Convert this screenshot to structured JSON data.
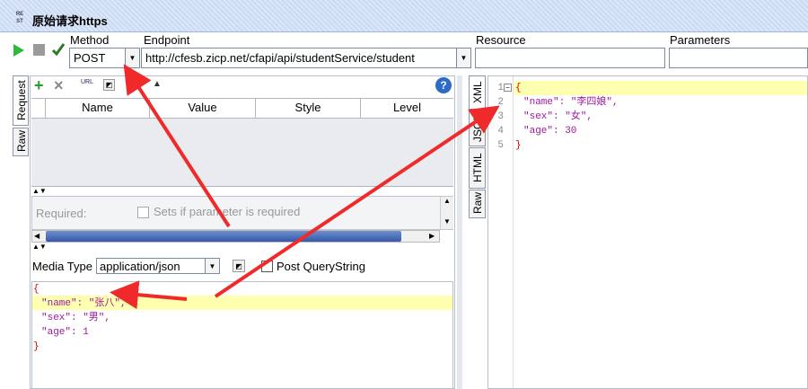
{
  "window": {
    "title": "原始请求https",
    "badge_top": "RE",
    "badge_bottom": "ST"
  },
  "toolbar": {
    "method_label": "Method",
    "method_value": "POST",
    "endpoint_label": "Endpoint",
    "endpoint_value": "http://cfesb.zicp.net/cfapi/api/studentService/student",
    "resource_label": "Resource",
    "parameters_label": "Parameters"
  },
  "request_tabs": {
    "request": "Request",
    "raw": "Raw"
  },
  "params_table": {
    "headers": [
      "Name",
      "Value",
      "Style",
      "Level"
    ]
  },
  "required": {
    "label": "Required:",
    "checkbox_label": "Sets if parameter is required"
  },
  "media": {
    "label": "Media Type",
    "value": "application/json",
    "post_qs_label": "Post QueryString"
  },
  "request_body": {
    "lines": [
      "{",
      "\"name\": \"张八\",",
      "\"sex\": \"男\",",
      "\"age\": 1",
      "}"
    ]
  },
  "response_tabs": {
    "xml": "XML",
    "json": "JSON",
    "html": "HTML",
    "raw": "Raw"
  },
  "response_body": {
    "line_numbers": [
      "1",
      "2",
      "3",
      "4",
      "5"
    ],
    "lines": [
      "{",
      "\"name\": \"李四娘\",",
      "\"sex\": \"女\",",
      "\"age\": 30",
      "}"
    ]
  },
  "colors": {
    "highlight": "#ffffb0",
    "arrow": "#f02a2a",
    "run": "#2dbb3a"
  }
}
